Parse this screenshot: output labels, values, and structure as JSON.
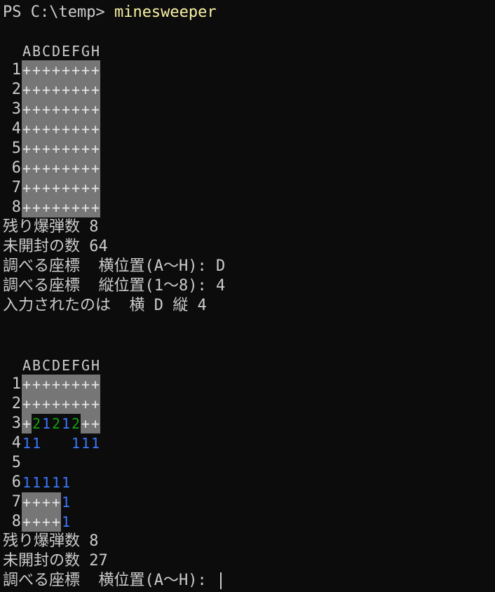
{
  "prompt": "PS C:\\temp> ",
  "command": "minesweeper",
  "columns": [
    "A",
    "B",
    "C",
    "D",
    "E",
    "F",
    "G",
    "H"
  ],
  "board1": {
    "rows": [
      {
        "num": "1",
        "cells": "++++++++"
      },
      {
        "num": "2",
        "cells": "++++++++"
      },
      {
        "num": "3",
        "cells": "++++++++"
      },
      {
        "num": "4",
        "cells": "++++++++"
      },
      {
        "num": "5",
        "cells": "++++++++"
      },
      {
        "num": "6",
        "cells": "++++++++"
      },
      {
        "num": "7",
        "cells": "++++++++"
      },
      {
        "num": "8",
        "cells": "++++++++"
      }
    ]
  },
  "status1": {
    "remaining_mines": "残り爆弾数 8",
    "unopened": "未開封の数 64",
    "ask_col": "調べる座標  横位置(A〜H): D",
    "ask_row": "調べる座標  縦位置(1〜8): 4",
    "echo": "入力されたのは  横 D 縦 4"
  },
  "board2": {
    "rows": [
      {
        "num": "1",
        "cells": "++++++++"
      },
      {
        "num": "2",
        "cells": "++++++++"
      },
      {
        "num": "3",
        "cells": "+21212++"
      },
      {
        "num": "4",
        "cells": "11   111"
      },
      {
        "num": "5",
        "cells": "        "
      },
      {
        "num": "6",
        "cells": "11111   "
      },
      {
        "num": "7",
        "cells": "++++1   "
      },
      {
        "num": "8",
        "cells": "++++1   "
      }
    ]
  },
  "status2": {
    "remaining_mines": "残り爆弾数 8",
    "unopened": "未開封の数 27",
    "ask_col": "調べる座標  横位置(A〜H): "
  },
  "colors": {
    "background": "#0c0c0c",
    "foreground": "#cccccc",
    "command": "#f9f1a5",
    "hidden_cell_bg": "#767676",
    "number_1": "#3b78ff",
    "number_2": "#13a10e"
  }
}
